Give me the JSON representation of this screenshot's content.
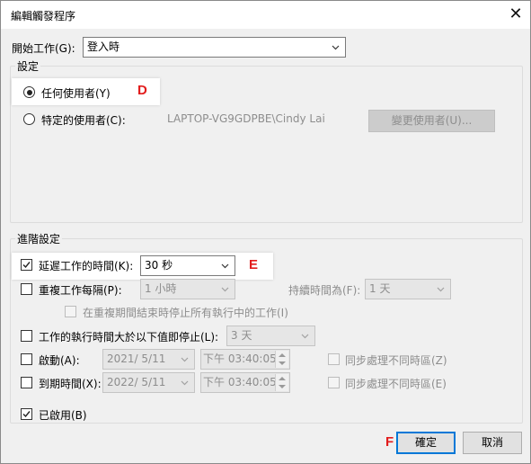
{
  "window": {
    "title": "編輯觸發程序"
  },
  "begin_task": {
    "label": "開始工作(G):",
    "value": "登入時"
  },
  "settings": {
    "group_label": "設定",
    "any_user": {
      "label": "任何使用者(Y)",
      "checked": true
    },
    "specific_user": {
      "label": "特定的使用者(C):",
      "checked": false,
      "user_value": "LAPTOP-VG9GDPBE\\Cindy Lai"
    },
    "change_user_button": "變更使用者(U)..."
  },
  "advanced": {
    "group_label": "進階設定",
    "delay": {
      "label": "延遲工作的時間(K):",
      "checked": true,
      "value": "30 秒"
    },
    "repeat": {
      "label": "重複工作每隔(P):",
      "checked": false,
      "value": "1 小時",
      "duration_label": "持續時間為(F):",
      "duration_value": "1 天"
    },
    "stop_running": {
      "label": "在重複期間結束時停止所有執行中的工作(I)",
      "checked": false
    },
    "stop_longer": {
      "label": "工作的執行時間大於以下值即停止(L):",
      "checked": false,
      "value": "3 天"
    },
    "activate": {
      "label": "啟動(A):",
      "checked": false,
      "date": "2021/  5/11",
      "time": "下午 03:40:05",
      "sync_label": "同步處理不同時區(Z)"
    },
    "expire": {
      "label": "到期時間(X):",
      "checked": false,
      "date": "2022/  5/11",
      "time": "下午 03:40:05",
      "sync_label": "同步處理不同時區(E)"
    },
    "enabled": {
      "label": "已啟用(B)",
      "checked": true
    }
  },
  "buttons": {
    "ok": "確定",
    "cancel": "取消"
  },
  "annotations": {
    "d": "D",
    "e": "E",
    "f": "F"
  },
  "colors": {
    "marker": "#e21c1c",
    "focus": "#0078d7"
  }
}
